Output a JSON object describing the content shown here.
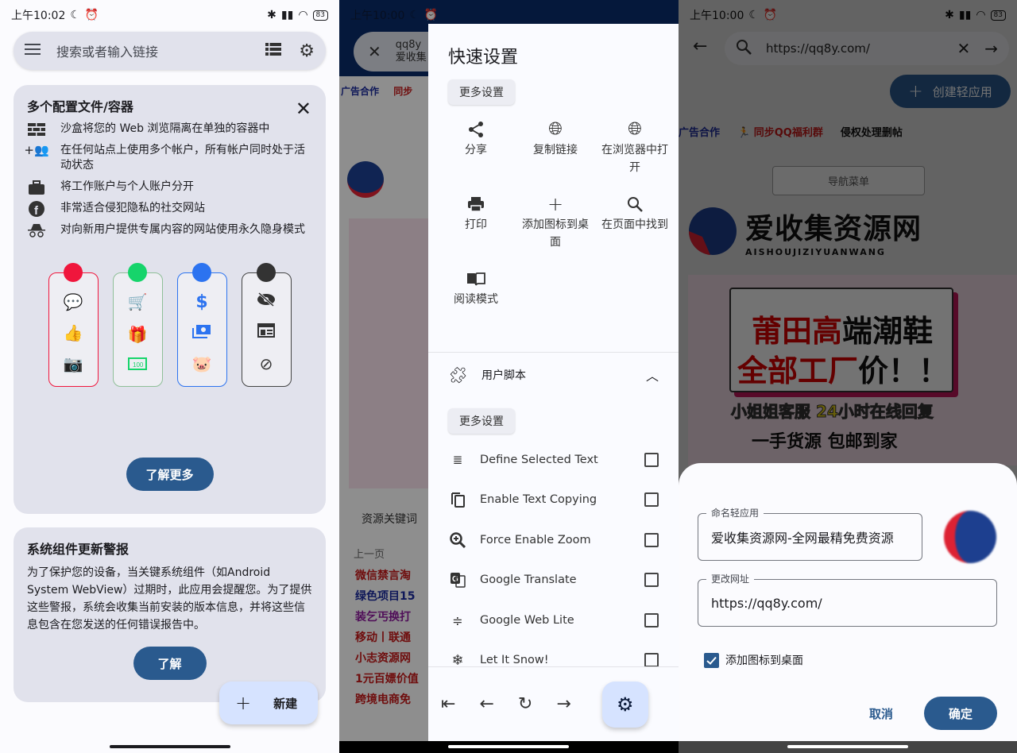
{
  "screen1": {
    "status": {
      "time": "上午10:02",
      "battery": "83"
    },
    "search": {
      "placeholder": "搜索或者输入链接",
      "menu_icon": "menu-icon",
      "list_icon": "list-icon",
      "settings_icon": "gear-icon"
    },
    "card_profiles": {
      "title": "多个配置文件/容器",
      "features": [
        {
          "icon": "wall-icon",
          "text": "沙盒将您的 Web 浏览隔离在单独的容器中"
        },
        {
          "icon": "group-add-icon",
          "text": "在任何站点上使用多个帐户，所有帐户同时处于活动状态"
        },
        {
          "icon": "briefcase-icon",
          "text": "将工作账户与个人账户分开"
        },
        {
          "icon": "facebook-icon",
          "text": "非常适合侵犯隐私的社交网站"
        },
        {
          "icon": "incognito-icon",
          "text": "对向新用户提供专属内容的网站使用永久隐身模式"
        }
      ],
      "containers": [
        {
          "color": "#f0163c",
          "icons": [
            "chat-icon",
            "thumbs-up-icon",
            "camera-icon"
          ]
        },
        {
          "color": "#16d46b",
          "icons": [
            "cart-icon",
            "gift-icon",
            "money-icon"
          ]
        },
        {
          "color": "#2c73f0",
          "icons": [
            "dollar-icon",
            "payments-icon",
            "piggy-bank-icon"
          ]
        },
        {
          "color": "#333333",
          "icons": [
            "eye-off-icon",
            "newspaper-icon",
            "fingerprint-off-icon"
          ]
        }
      ],
      "learn_more": "了解更多"
    },
    "card_update": {
      "title": "系统组件更新警报",
      "body": "为了保护您的设备，当关键系统组件（如Android System WebView）过期时，此应用会提醒您。为了提供这些警报，系统会收集当前安装的版本信息，并将这些信息包含在您发送的任何错误报告中。",
      "button": "了解"
    },
    "fab": {
      "label": "新建"
    }
  },
  "screen2": {
    "status": {
      "time": "上午10:00"
    },
    "url_bar": {
      "line1": "qq8y",
      "line2": "爱收集"
    },
    "page_bg_text": {
      "nav1": "广告合作",
      "nav2": "同步",
      "tab": "资源关键词",
      "prev": "上一页",
      "items": [
        "微信禁言淘",
        "绿色项目15",
        "装乞丐换打",
        "移动丨联通",
        "小志资源网",
        "1元百嫖价值",
        "跨境电商免"
      ]
    },
    "drawer": {
      "title": "快速设置",
      "more_settings": "更多设置",
      "quick_actions": [
        {
          "icon": "share-icon",
          "label": "分享"
        },
        {
          "icon": "globe-icon",
          "label": "复制链接"
        },
        {
          "icon": "globe-icon",
          "label": "在浏览器中打开"
        },
        {
          "icon": "print-icon",
          "label": "打印"
        },
        {
          "icon": "plus-icon",
          "label": "添加图标到桌面"
        },
        {
          "icon": "search-icon",
          "label": "在页面中找到"
        },
        {
          "icon": "book-icon",
          "label": "阅读模式"
        }
      ],
      "userscripts": {
        "title": "用户脚本",
        "more_settings": "更多设置",
        "scripts": [
          {
            "icon": "define-text-icon",
            "label": "Define Selected Text",
            "checked": false
          },
          {
            "icon": "copy-icon",
            "label": "Enable Text Copying",
            "checked": false
          },
          {
            "icon": "zoom-in-icon",
            "label": "Force Enable Zoom",
            "checked": false
          },
          {
            "icon": "translate-icon",
            "label": "Google Translate",
            "checked": false
          },
          {
            "icon": "compress-icon",
            "label": "Google Web Lite",
            "checked": false
          },
          {
            "icon": "snowflake-icon",
            "label": "Let It Snow!",
            "checked": false
          }
        ]
      }
    }
  },
  "screen3": {
    "status": {
      "time": "上午10:00",
      "battery": "83"
    },
    "url_bar": {
      "value": "https://qq8y.com/"
    },
    "create_button": "创建轻应用",
    "page": {
      "nav_links": [
        "广告合作",
        "同步QQ福利群",
        "侵权处理删帖"
      ],
      "nav_menu": "导航菜单",
      "logo_cn": "爱收集资源网",
      "logo_en": "AISHOUJIZIYUANWANG",
      "banner_line1_red": "莆田高",
      "banner_line1_black": "端潮鞋",
      "banner_line2_red": "全部工厂",
      "banner_line2_black": "价！！",
      "banner_yellow": "小姐姐客服 24小时在线回复",
      "banner_black": "一手货源 包邮到家"
    },
    "dialog": {
      "name_label": "命名轻应用",
      "name_value": "爱收集资源网-全网最精免费资源",
      "url_label": "更改网址",
      "url_value": "https://qq8y.com/",
      "checkbox_label": "添加图标到桌面",
      "checkbox_checked": true,
      "cancel": "取消",
      "confirm": "确定"
    }
  }
}
